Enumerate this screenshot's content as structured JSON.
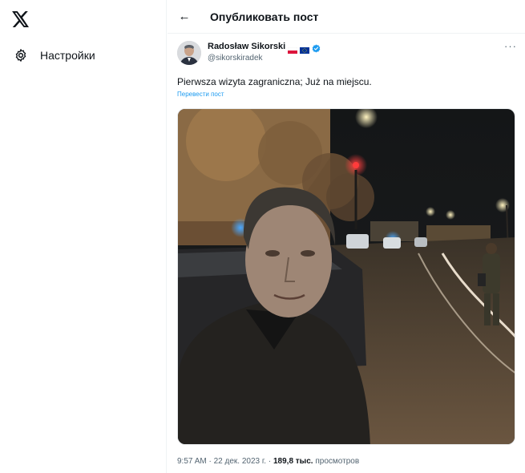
{
  "sidebar": {
    "logo_icon": "x-logo-icon",
    "settings_icon": "gear-icon",
    "settings_label": "Настройки"
  },
  "header": {
    "back_icon": "arrow-left-icon",
    "back_glyph": "←",
    "title": "Опубликовать пост"
  },
  "post": {
    "author_name": "Radosław Sikorski",
    "author_handle": "@sikorskiradek",
    "flags": [
      "poland-flag-icon",
      "eu-flag-icon"
    ],
    "verified_icon": "verified-badge-icon",
    "more_icon": "more-horizontal-icon",
    "more_glyph": "···",
    "text": "Pierwsza wizyta zagraniczna; Już na miejscu.",
    "translate_label": "Перевести пост",
    "image_icon": "post-photo",
    "time": "9:57 AM",
    "date": "22 дек. 2023 г.",
    "views_count": "189,8 тыс.",
    "views_label": "просмотров",
    "separator": "·"
  },
  "colors": {
    "accent": "#1d9bf0",
    "text": "#0f1419",
    "secondary": "#536471",
    "border": "#eff3f4",
    "poland_red": "#dc143c",
    "eu_blue": "#003399"
  }
}
